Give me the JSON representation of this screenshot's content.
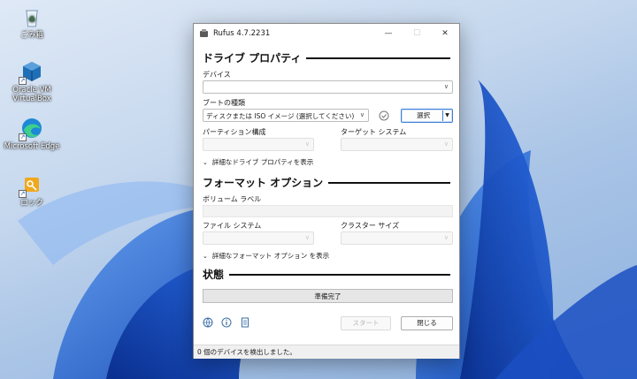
{
  "desktop": {
    "icons": [
      {
        "label": "ごみ箱",
        "icon": "recycle-bin-icon"
      },
      {
        "label": "Oracle VM VirtualBox",
        "icon": "virtualbox-icon"
      },
      {
        "label": "Microsoft Edge",
        "icon": "edge-icon"
      },
      {
        "label": "ロック",
        "icon": "lock-key-icon"
      }
    ]
  },
  "window": {
    "title": "Rufus 4.7.2231",
    "controls": {
      "minimize": "—",
      "maximize": "☐",
      "close": "✕"
    }
  },
  "drive_properties": {
    "heading": "ドライブ プロパティ",
    "device_label": "デバイス",
    "device_value": "",
    "boot_label": "ブートの種類",
    "boot_value": "ディスクまたは ISO イメージ (選択してください)",
    "select_button": "選択",
    "partition_label": "パーティション構成",
    "target_label": "ターゲット システム",
    "advanced_toggle": "詳細なドライブ プロパティを表示"
  },
  "format_options": {
    "heading": "フォーマット オプション",
    "volume_label": "ボリューム ラベル",
    "filesystem_label": "ファイル システム",
    "cluster_label": "クラスター サイズ",
    "advanced_toggle": "詳細なフォーマット オプション を表示"
  },
  "status": {
    "heading": "状態",
    "progress_text": "準備完了",
    "progress_fraction": 0
  },
  "footer": {
    "start_button": "スタート",
    "close_button": "閉じる",
    "statusbar_text": "0 個のデバイスを検出しました。"
  },
  "colors": {
    "accent": "#3b7dd8",
    "wallpaper_blue": "#1f5fd6"
  }
}
